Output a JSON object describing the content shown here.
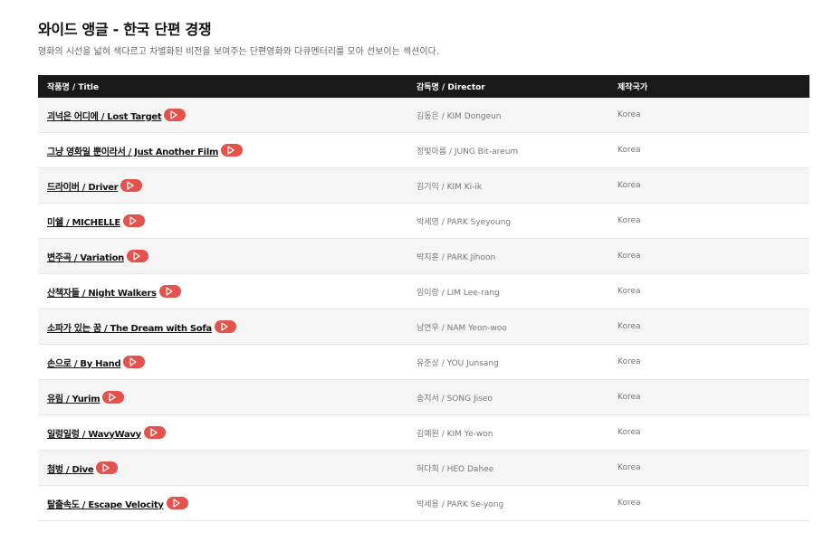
{
  "section": {
    "title": "와이드 앵글 - 한국 단편 경쟁",
    "description": "영화의 시선을 넓혀 색다르고 차별화된 비전을 보여주는 단편영화와 다큐멘터리를 모아 선보이는 섹션이다."
  },
  "table": {
    "headers": [
      "작품명 / Title",
      "감독명 / Director",
      "제작국가"
    ],
    "rows": [
      {
        "title": "괴넉은 어디에 / Lost Target",
        "director": "김동은 / KIM Dongeun",
        "country": "Korea"
      },
      {
        "title": "그냥 영화일 뿐이라서 / Just Another Film",
        "director": "정빛아름 / JUNG Bit-areum",
        "country": "Korea"
      },
      {
        "title": "드라이버 / Driver",
        "director": "김기익 / KIM Ki-ik",
        "country": "Korea"
      },
      {
        "title": "미쉘 / MICHELLE",
        "director": "박세영 / PARK Syeyoung",
        "country": "Korea"
      },
      {
        "title": "변주곡 / Variation",
        "director": "박지훈 / PARK Jihoon",
        "country": "Korea"
      },
      {
        "title": "산책자들 / Night Walkers",
        "director": "임이랑 / LIM Lee-rang",
        "country": "Korea"
      },
      {
        "title": "소파가 있는 꿈 / The Dream with Sofa",
        "director": "남연우 / NAM Yeon-woo",
        "country": "Korea"
      },
      {
        "title": "손으로 / By Hand",
        "director": "유준상 / YOU Junsang",
        "country": "Korea"
      },
      {
        "title": "유림 / Yurim",
        "director": "송지서 / SONG Jiseo",
        "country": "Korea"
      },
      {
        "title": "일렁일렁 / WavyWavy",
        "director": "김예원 / KIM Ye-won",
        "country": "Korea"
      },
      {
        "title": "첨벙 / Dive",
        "director": "허다희 / HEO Dahee",
        "country": "Korea"
      },
      {
        "title": "탈출속도 / Escape Velocity",
        "director": "박세용 / PARK Se-yong",
        "country": "Korea"
      }
    ]
  },
  "icons": {
    "play": "play-icon"
  },
  "colors": {
    "header_bg": "#1a1a1a",
    "play_button": "#e5514b",
    "stripe": "#f5f5f5"
  }
}
